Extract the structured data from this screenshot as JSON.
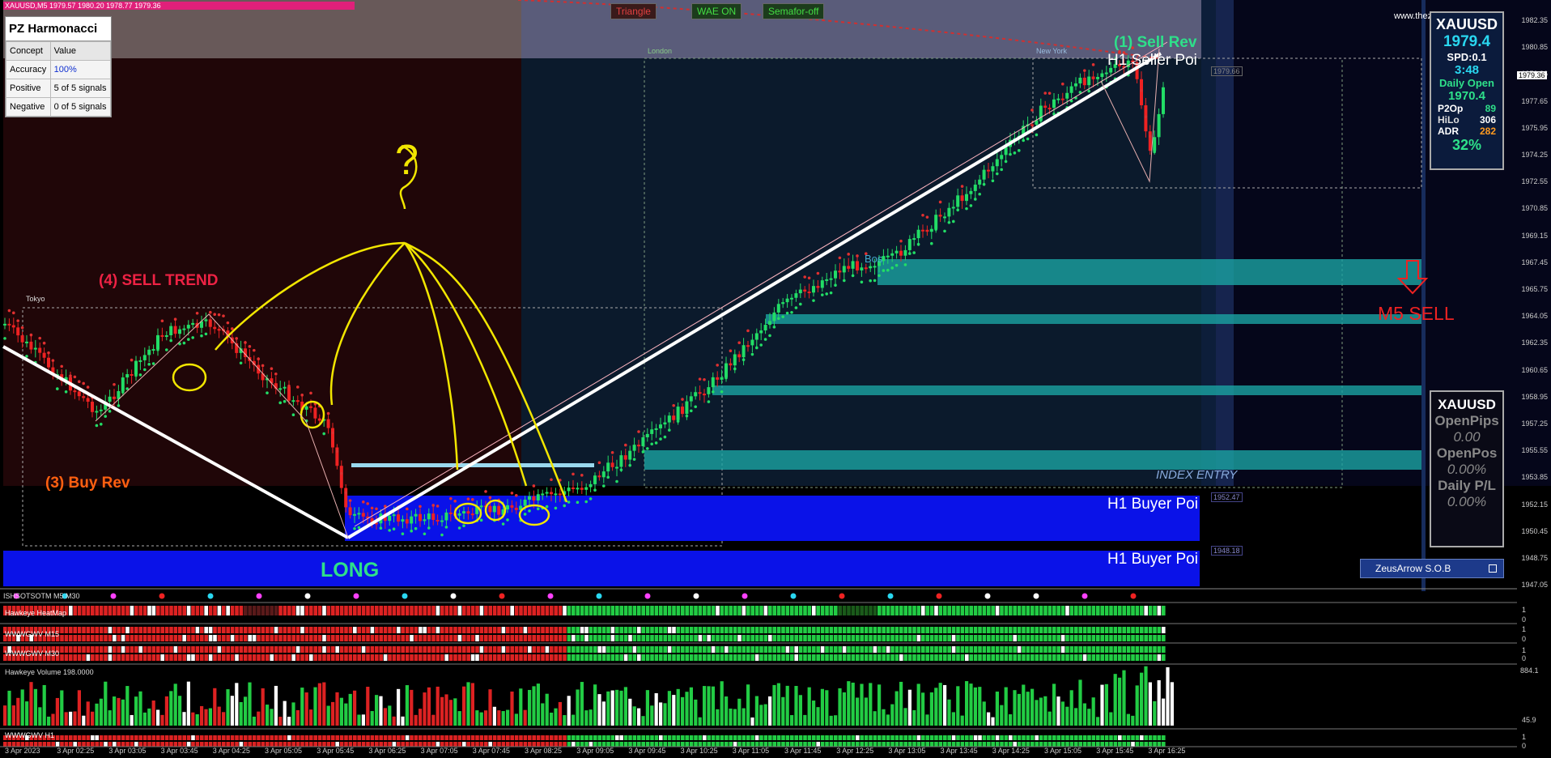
{
  "chart_header": "XAUUSD,M5  1979.57 1980.20 1978.77 1979.36",
  "watermark": "www.thezeusarrow.com",
  "buttons": [
    {
      "label": "Triangle",
      "color": "#d04040"
    },
    {
      "label": "WAE ON",
      "color": "#40d040"
    },
    {
      "label": "Semafor-off",
      "color": "#40d040"
    }
  ],
  "harmonacci": {
    "title": "PZ Harmonacci",
    "col_concept": "Concept",
    "col_value": "Value",
    "rows": [
      {
        "concept": "Accuracy",
        "value": "100%"
      },
      {
        "concept": "Positive",
        "value": "5 of 5 signals"
      },
      {
        "concept": "Negative",
        "value": "0 of 5 signals"
      }
    ]
  },
  "sessions": {
    "tokyo": "Tokyo",
    "london": "London",
    "new_york": "New York"
  },
  "annotations": {
    "sell_trend": "(4) SELL TREND",
    "buy_rev": "(3) Buy Rev",
    "long": "LONG",
    "sell_rev": "(1) Sell Rev",
    "h1_seller": "H1 Seller Poi",
    "h1_buyer_1": "H1 Buyer Poi",
    "h1_buyer_2": "H1 Buyer Poi",
    "index_entry": "INDEX ENTRY",
    "m5_sell": "M5 SELL",
    "bos": "Bos",
    "question": "?",
    "seller_price": "1979.66",
    "buyer_price_1": "1952.47",
    "buyer_price_2": "1948.18"
  },
  "info_panel": {
    "symbol": "XAUUSD",
    "price": "1979.4",
    "spd": "SPD:0.1",
    "timer": "3:48",
    "daily_open_label": "Daily Open",
    "daily_open": "1970.4",
    "p2op_label": "P2Op",
    "p2op": "89",
    "hilo_label": "HiLo",
    "hilo": "306",
    "adr_label": "ADR",
    "adr": "282",
    "pct": "32%"
  },
  "pos_panel": {
    "symbol": "XAUUSD",
    "open_pips_label": "OpenPips",
    "open_pips": "0.00",
    "open_pos_label": "OpenPos",
    "open_pos": "0.00%",
    "daily_pl_label": "Daily P/L",
    "daily_pl": "0.00%"
  },
  "sob_label": "ZeusArrow S.O.B",
  "price_axis": [
    "1982.35",
    "1980.85",
    "1979.36",
    "1977.65",
    "1975.95",
    "1974.25",
    "1972.55",
    "1970.85",
    "1969.15",
    "1967.45",
    "1965.75",
    "1964.05",
    "1962.35",
    "1960.65",
    "1958.95",
    "1957.25",
    "1955.55",
    "1953.85",
    "1952.15",
    "1950.45",
    "1948.75",
    "1947.05"
  ],
  "current_price_tag": "1979.36",
  "subwindows": {
    "w1": "ISHSOTSOTM M5 M30",
    "w2": "Hawkeye HeatMap",
    "w3": "WWWGWV M15",
    "w4": "WWWGWV M30",
    "volume": "Hawkeye Volume 198.0000",
    "w6": "WWWGWV H1",
    "volume_max": "884.1",
    "volume_min": "45.9"
  },
  "sub_scale": [
    "1",
    "0",
    "1",
    "0",
    "1",
    "0",
    "1",
    "0"
  ],
  "time_axis": [
    "3 Apr 2023",
    "3 Apr 02:25",
    "3 Apr 03:05",
    "3 Apr 03:45",
    "3 Apr 04:25",
    "3 Apr 05:05",
    "3 Apr 05:45",
    "3 Apr 06:25",
    "3 Apr 07:05",
    "3 Apr 07:45",
    "3 Apr 08:25",
    "3 Apr 09:05",
    "3 Apr 09:45",
    "3 Apr 10:25",
    "3 Apr 11:05",
    "3 Apr 11:45",
    "3 Apr 12:25",
    "3 Apr 13:05",
    "3 Apr 13:45",
    "3 Apr 14:25",
    "3 Apr 15:05",
    "3 Apr 15:45",
    "3 Apr 16:25"
  ],
  "colors": {
    "bull": "#22dd66",
    "bear": "#ee2222",
    "buyer_zone": "#0a12e8",
    "teal": "#1aa3a3",
    "annot": "#f2e600"
  }
}
